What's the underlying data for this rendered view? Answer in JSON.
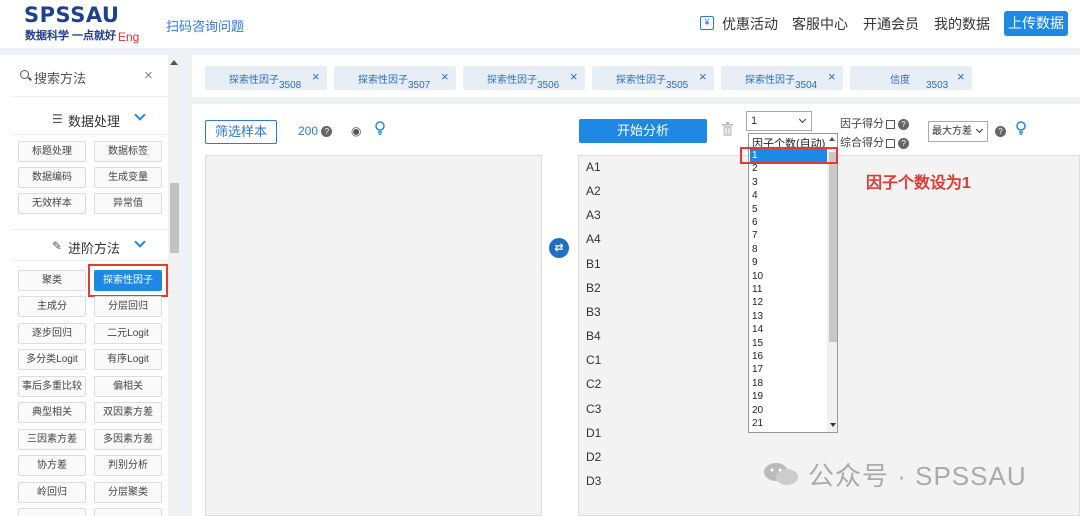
{
  "header": {
    "logo": "SPSSAU",
    "slogan": "数据科学 一点就好",
    "eng": "Eng",
    "consult_link": "扫码咨询问题",
    "nav": [
      "优惠活动",
      "客服中心",
      "开通会员",
      "我的数据"
    ],
    "upload": "上传数据"
  },
  "sidebar": {
    "search_placeholder": "搜索方法",
    "section1": "数据处理",
    "section1_items": [
      "标题处理",
      "数据标签",
      "数据编码",
      "生成变量",
      "无效样本",
      "异常值"
    ],
    "section2": "进阶方法",
    "section2_items": [
      "聚类",
      "探索性因子",
      "主成分",
      "分层回归",
      "逐步回归",
      "二元Logit",
      "多分类Logit",
      "有序Logit",
      "事后多重比较",
      "偏相关",
      "典型相关",
      "双因素方差",
      "三因素方差",
      "多因素方差",
      "协方差",
      "判别分析",
      "岭回归",
      "分层聚类"
    ]
  },
  "tabs": [
    {
      "label": "探索性因子",
      "num": "3508"
    },
    {
      "label": "探索性因子",
      "num": "3507"
    },
    {
      "label": "探索性因子",
      "num": "3506"
    },
    {
      "label": "探索性因子",
      "num": "3505"
    },
    {
      "label": "探索性因子",
      "num": "3504"
    },
    {
      "label": "信度",
      "num": "3503"
    }
  ],
  "toolbar": {
    "filter": "筛选样本",
    "count": "200",
    "start": "开始分析",
    "factor_select_value": "1",
    "factor_score": "因子得分",
    "composite_score": "综合得分",
    "method": "最大方差"
  },
  "variables": [
    "A1",
    "A2",
    "A3",
    "A4",
    "B1",
    "B2",
    "B3",
    "B4",
    "C1",
    "C2",
    "C3",
    "D1",
    "D2",
    "D3"
  ],
  "dropdown": {
    "header": "因子个数(自动)",
    "options": [
      "1",
      "2",
      "3",
      "4",
      "5",
      "6",
      "7",
      "8",
      "9",
      "10",
      "11",
      "12",
      "13",
      "14",
      "15",
      "16",
      "17",
      "18",
      "19",
      "20",
      "21"
    ]
  },
  "annotation": "因子个数设为1",
  "watermark": "公众号 · SPSSAU"
}
